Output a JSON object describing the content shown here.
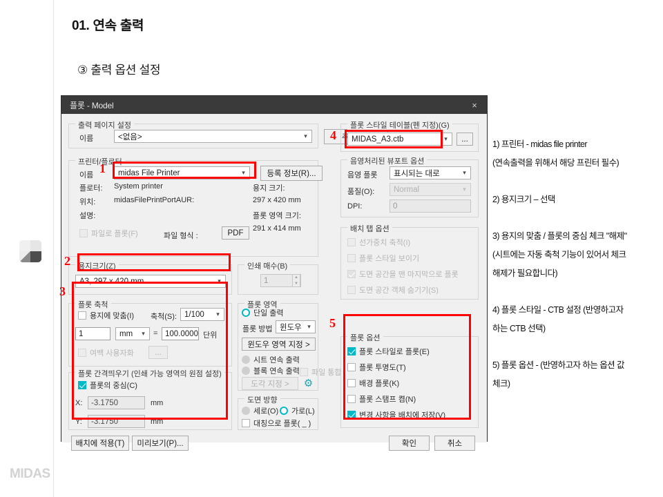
{
  "slide": {
    "title": "01. 연속 출력",
    "subtitle": "③ 출력 옵션 설정",
    "logo": "MIDAS"
  },
  "dialog": {
    "title": "플롯 - Model",
    "close_icon": "×",
    "page_setup": {
      "group_label": "출력 페이지 설정",
      "name_label": "이름",
      "name_value": "<없음>",
      "add_button": "추가(.)..."
    },
    "printer": {
      "group_label": "프린터/플로터",
      "name_label": "이름",
      "name_value": "midas File Printer",
      "info_button": "등록 정보(R)...",
      "plotter_label": "플로터:",
      "plotter_value": "System printer",
      "location_label": "위치:",
      "location_value": "midasFilePrintPortAUR:",
      "description_label": "설명:",
      "description_value": "",
      "plot_to_file_label": "파일로 플롯(F)",
      "file_format_label": "파일 형식 :",
      "file_format_value": "PDF",
      "paper_size_label": "용지 크기:",
      "paper_size_value": "297 x 420 mm",
      "plot_area_size_label": "플롯 영역 크기:",
      "plot_area_size_value": "291 x 414 mm"
    },
    "paper_size": {
      "group_label": "용지크기(Z)",
      "value": "A3, 297 x 420 mm"
    },
    "plot_scale": {
      "group_label": "플롯 축척",
      "fit_to_paper_label": "용지에 맞춤(I)",
      "fit_to_paper_checked": false,
      "scale_label": "축척(S):",
      "scale_value": "1/100",
      "unit_numerator": "1",
      "unit_select": "mm",
      "equals": "=",
      "unit_denominator": "100.0000",
      "unit_suffix": "단위",
      "custom_margin_label": "여백 사용자화",
      "custom_margin_button": "..."
    },
    "plot_offset": {
      "group_label": "플롯 간격띄우기 (인쇄 가능 영역의 원점 설정)",
      "center_label": "플롯의 중심(C)",
      "center_checked": true,
      "x_label": "X:",
      "x_value": "-3.1750",
      "x_unit": "mm",
      "y_label": "Y:",
      "y_value": "-3.1750",
      "y_unit": "mm"
    },
    "copies": {
      "group_label": "인쇄 매수(B)",
      "value": "1"
    },
    "plot_region": {
      "group_label": "플롯 영역",
      "single_output_label": "단일 출력",
      "single_output_selected": true,
      "method_label": "플롯 방법",
      "method_value": "윈도우",
      "window_button": "윈도우 영역 지정 >",
      "sheet_continuous_label": "시트 연속 출력",
      "block_continuous_label": "블록 연속 출력",
      "merge_files_label": "파일 통합",
      "shape_button": "도각 지정 >",
      "gear_icon": "gear-icon"
    },
    "orientation": {
      "group_label": "도면 방향",
      "portrait_label": "세로(O)",
      "landscape_label": "가로(L)",
      "landscape_selected": true,
      "upside_down_label": "대칭으로 플롯( _ )"
    },
    "plot_style_table": {
      "group_label": "플롯 스타일 테이블(펜 지정)(G)",
      "value": "MIDAS_A3.ctb",
      "browse_button": "..."
    },
    "shaded_viewport": {
      "group_label": "음영처리된 뷰포트 옵션",
      "shade_plot_label": "음영 플롯",
      "shade_plot_value": "표시되는 대로",
      "quality_label": "품질(O):",
      "quality_value": "Normal",
      "dpi_label": "DPI:",
      "dpi_value": "0"
    },
    "batch_tab": {
      "group_label": "배치 탭 옵션",
      "items": [
        {
          "label": "선가중치 축적(I)",
          "checked": false
        },
        {
          "label": "플롯 스타일 보이기",
          "checked": false
        },
        {
          "label": "도면 공간을 맨 마지막으로 플롯",
          "checked": true
        },
        {
          "label": "도면 공간 객체 숨기기(S)",
          "checked": false
        }
      ]
    },
    "plot_options": {
      "group_label": "플롯 옵션",
      "items": [
        {
          "label": "플롯 스타일로 플롯(E)",
          "checked": true
        },
        {
          "label": "플롯 투명도(T)",
          "checked": false
        },
        {
          "label": "배경 플롯(K)",
          "checked": false
        },
        {
          "label": "플롯 스탬프 켬(N)",
          "checked": false
        },
        {
          "label": "변경 사항을 배치에 저장(V)",
          "checked": true
        }
      ]
    },
    "footer": {
      "apply_to_layout": "배치에 적용(T)",
      "preview": "미리보기(P)...",
      "ok": "확인",
      "cancel": "취소"
    }
  },
  "callouts": {
    "marker_1": "1",
    "marker_2": "2",
    "marker_3": "3",
    "marker_4": "4",
    "marker_5": "5",
    "accent_color": "#ff0000"
  },
  "annotations": {
    "lines": [
      "1) 프린터 - midas file printer",
      "(연속출력을 위해서 해당 프린터 필수)",
      "2) 용지크기 – 선택",
      "3) 용지의 맞춤 / 플롯의 중심 체크 \"해제\"",
      "(시트에는 자동 축척 기능이 있어서 체크",
      "해제가 필요합니다)",
      "4) 플롯 스타일 - CTB 설정 (반영하고자",
      "하는 CTB 선택)",
      "5) 플롯 옵션 - (반영하고자 하는 옵션 값",
      "체크)"
    ]
  }
}
